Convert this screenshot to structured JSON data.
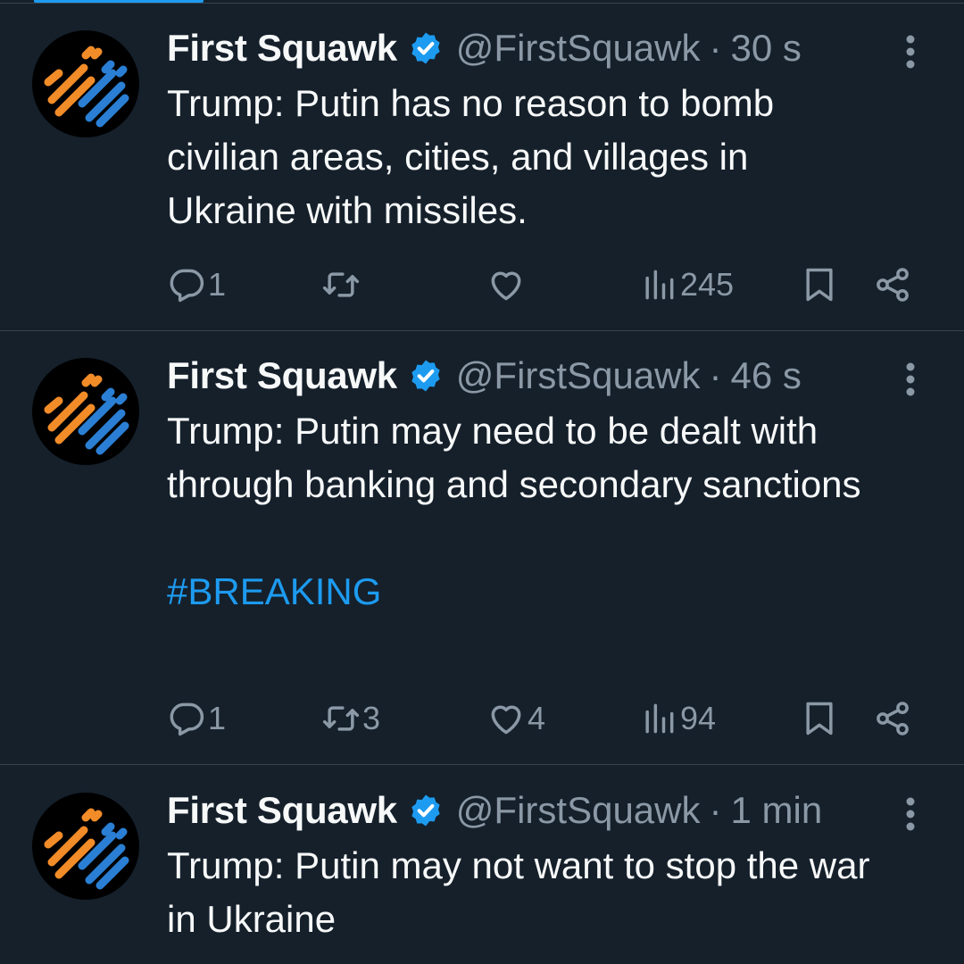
{
  "tweets": [
    {
      "name": "First Squawk",
      "handle": "@FirstSquawk",
      "separator": "·",
      "time": "30 s",
      "text_lines": [
        "Trump: Putin has no reason to bomb civilian areas, cities, and villages in Ukraine with missiles."
      ],
      "hashtag": "",
      "replies": "1",
      "retweets": "",
      "likes": "",
      "views": "245"
    },
    {
      "name": "First Squawk",
      "handle": "@FirstSquawk",
      "separator": "·",
      "time": "46 s",
      "text_lines": [
        "Trump: Putin may need to be dealt with through banking and secondary sanctions"
      ],
      "hashtag": "#BREAKING",
      "replies": "1",
      "retweets": "3",
      "likes": "4",
      "views": "94"
    },
    {
      "name": "First Squawk",
      "handle": "@FirstSquawk",
      "separator": "·",
      "time": "1 min",
      "text_lines": [
        "Trump: Putin may not want to stop the war in Ukraine"
      ],
      "hashtag": "",
      "replies": "",
      "retweets": "",
      "likes": "",
      "views": ""
    }
  ],
  "icons": {
    "avatar": "first-squawk-logo",
    "verified": "verified-badge-icon",
    "more": "more-vertical-icon",
    "reply": "reply-icon",
    "retweet": "retweet-icon",
    "like": "heart-icon",
    "views": "views-icon",
    "bookmark": "bookmark-icon",
    "share": "share-icon"
  },
  "colors": {
    "background": "#15202b",
    "text": "#f7f9f9",
    "secondary": "#8b98a5",
    "accent": "#1d9bf0",
    "divider": "#38444d",
    "logo_orange": "#f28c28",
    "logo_blue": "#2a7fd4"
  }
}
